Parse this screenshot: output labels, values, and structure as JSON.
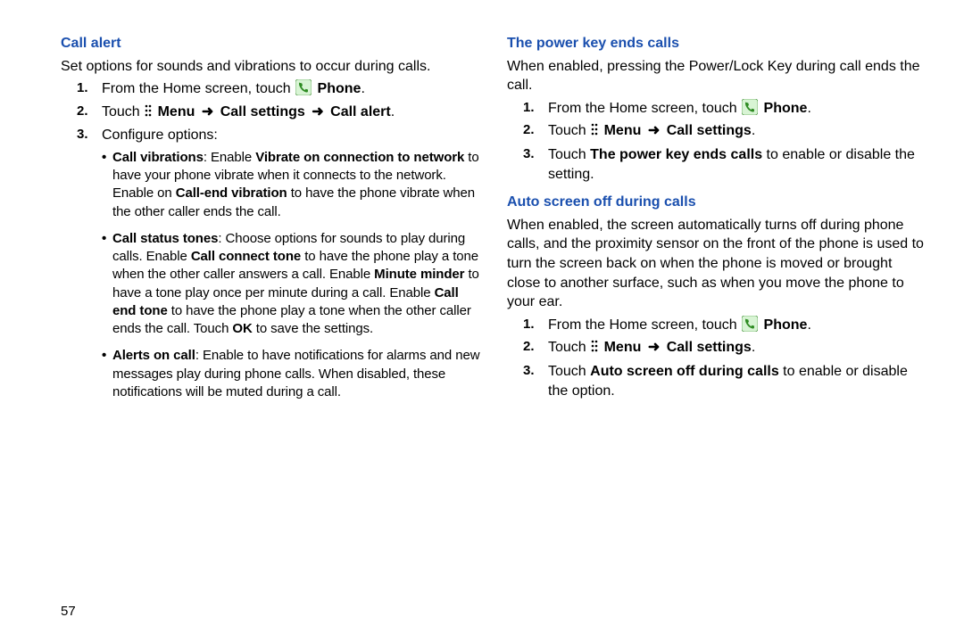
{
  "pagenum": "57",
  "arrow_glyph": "➜",
  "left": {
    "h_call_alert": "Call alert",
    "intro": "Set options for sounds and vibrations to occur during calls.",
    "s1_pre": "From the Home screen, touch ",
    "s1_phone": "Phone",
    "s1_post": ".",
    "s2_pre": "Touch ",
    "s2_menu": "Menu",
    "s2_b2": "Call settings",
    "s2_b3": "Call alert",
    "s2_post": ".",
    "s3": "Configure options:",
    "bul1_b1": "Call vibrations",
    "bul1_t1": ": Enable ",
    "bul1_b2": "Vibrate on connection to network",
    "bul1_t2": " to have your phone vibrate when it connects to the network. Enable on ",
    "bul1_b3": "Call-end vibration",
    "bul1_t3": " to have the phone vibrate when the other caller ends the call.",
    "bul2_b1": "Call status tones",
    "bul2_t1": ": Choose options for sounds to play during calls. Enable ",
    "bul2_b2": "Call connect tone",
    "bul2_t2": " to have the phone play a tone when the other caller answers a call. Enable ",
    "bul2_b3": "Minute minder",
    "bul2_t3": " to have a tone play once per minute during a call. Enable ",
    "bul2_b4": "Call end tone",
    "bul2_t4": " to have the phone play a tone when the other caller ends the call. Touch ",
    "bul2_b5": "OK",
    "bul2_t5": " to save the settings.",
    "bul3_b1": "Alerts on call",
    "bul3_t1": ": Enable to have notifications for alarms and new messages play during phone calls. When disabled, these notifications will be muted during a call."
  },
  "right": {
    "h_power": "The power key ends calls",
    "power_intro": "When enabled, pressing the Power/Lock Key during call ends the call.",
    "p_s1_pre": "From the Home screen, touch ",
    "p_s1_phone": "Phone",
    "p_s1_post": ".",
    "p_s2_pre": "Touch ",
    "p_s2_menu": "Menu",
    "p_s2_b2": "Call settings",
    "p_s2_post": ".",
    "p_s3_t1": "Touch ",
    "p_s3_b1": "The power key ends calls",
    "p_s3_t2": " to enable or disable the setting.",
    "h_auto": "Auto screen off during calls",
    "auto_intro": "When enabled, the screen automatically turns off during phone calls, and the proximity sensor on the front of the phone is used to turn the screen back on when the phone is moved or brought close to another surface, such as when you move the phone to your ear.",
    "a_s1_pre": "From the Home screen, touch ",
    "a_s1_phone": "Phone",
    "a_s1_post": ".",
    "a_s2_pre": "Touch ",
    "a_s2_menu": "Menu",
    "a_s2_b2": "Call settings",
    "a_s2_post": ".",
    "a_s3_t1": "Touch ",
    "a_s3_b1": "Auto screen off during calls",
    "a_s3_t2": " to enable or disable the option."
  }
}
